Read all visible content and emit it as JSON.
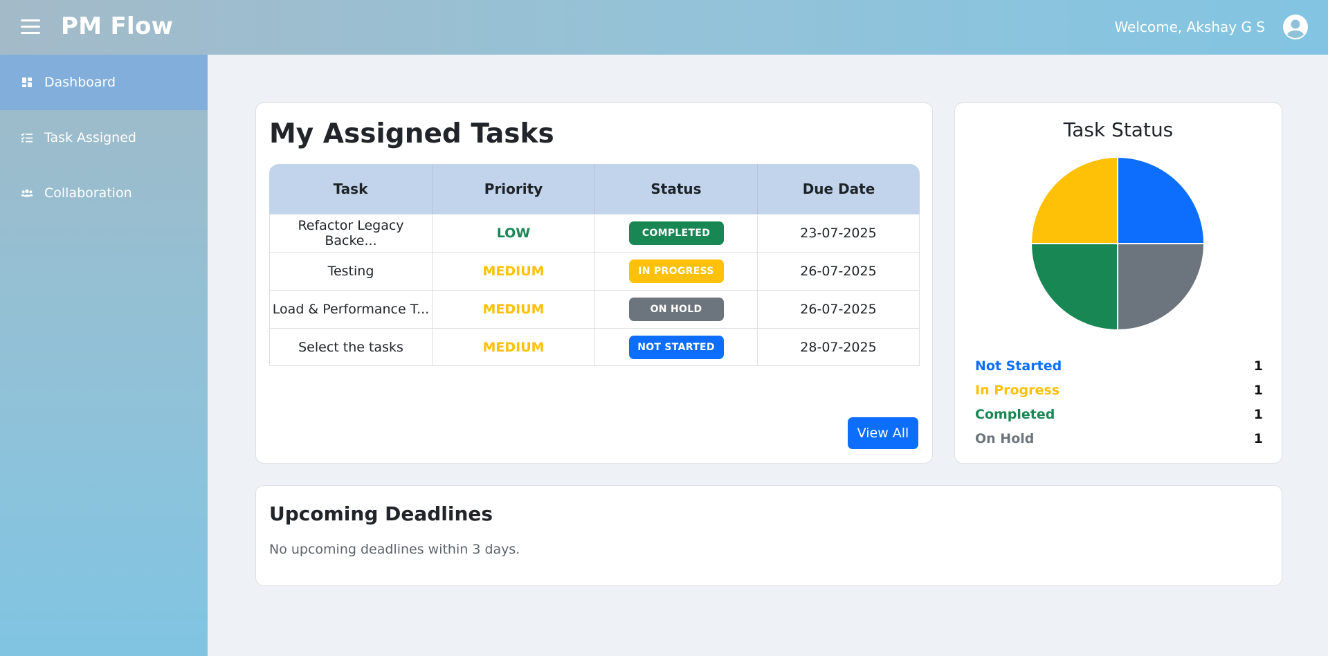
{
  "header": {
    "brand": "PM Flow",
    "welcome": "Welcome, Akshay G S"
  },
  "sidebar": {
    "items": [
      {
        "label": "Dashboard",
        "icon": "dashboard-icon",
        "active": true
      },
      {
        "label": "Task Assigned",
        "icon": "task-list-icon",
        "active": false
      },
      {
        "label": "Collaboration",
        "icon": "users-icon",
        "active": false
      }
    ]
  },
  "tasks": {
    "title": "My Assigned Tasks",
    "columns": [
      "Task",
      "Priority",
      "Status",
      "Due Date"
    ],
    "rows": [
      {
        "task": "Refactor Legacy Backe...",
        "priority": "LOW",
        "priority_color": "#198754",
        "status": "COMPLETED",
        "status_color": "#198754",
        "due": "23-07-2025"
      },
      {
        "task": "Testing",
        "priority": "MEDIUM",
        "priority_color": "#ffc107",
        "status": "IN PROGRESS",
        "status_color": "#ffc107",
        "due": "26-07-2025"
      },
      {
        "task": "Load & Performance T...",
        "priority": "MEDIUM",
        "priority_color": "#ffc107",
        "status": "ON HOLD",
        "status_color": "#6c757d",
        "due": "26-07-2025"
      },
      {
        "task": "Select the tasks",
        "priority": "MEDIUM",
        "priority_color": "#ffc107",
        "status": "NOT STARTED",
        "status_color": "#0d6efd",
        "due": "28-07-2025"
      }
    ],
    "view_all": "View All"
  },
  "status_panel": {
    "title": "Task Status",
    "legend": [
      {
        "label": "Not Started",
        "count": "1",
        "color": "#0d6efd"
      },
      {
        "label": "In Progress",
        "count": "1",
        "color": "#ffc107"
      },
      {
        "label": "Completed",
        "count": "1",
        "color": "#198754"
      },
      {
        "label": "On Hold",
        "count": "1",
        "color": "#6c757d"
      }
    ]
  },
  "chart_data": {
    "type": "pie",
    "categories": [
      "Not Started",
      "On Hold",
      "Completed",
      "In Progress"
    ],
    "values": [
      1,
      1,
      1,
      1
    ],
    "colors": [
      "#0d6efd",
      "#6c757d",
      "#198754",
      "#ffc107"
    ],
    "title": "Task Status"
  },
  "deadlines": {
    "title": "Upcoming Deadlines",
    "message": "No upcoming deadlines within 3 days."
  }
}
